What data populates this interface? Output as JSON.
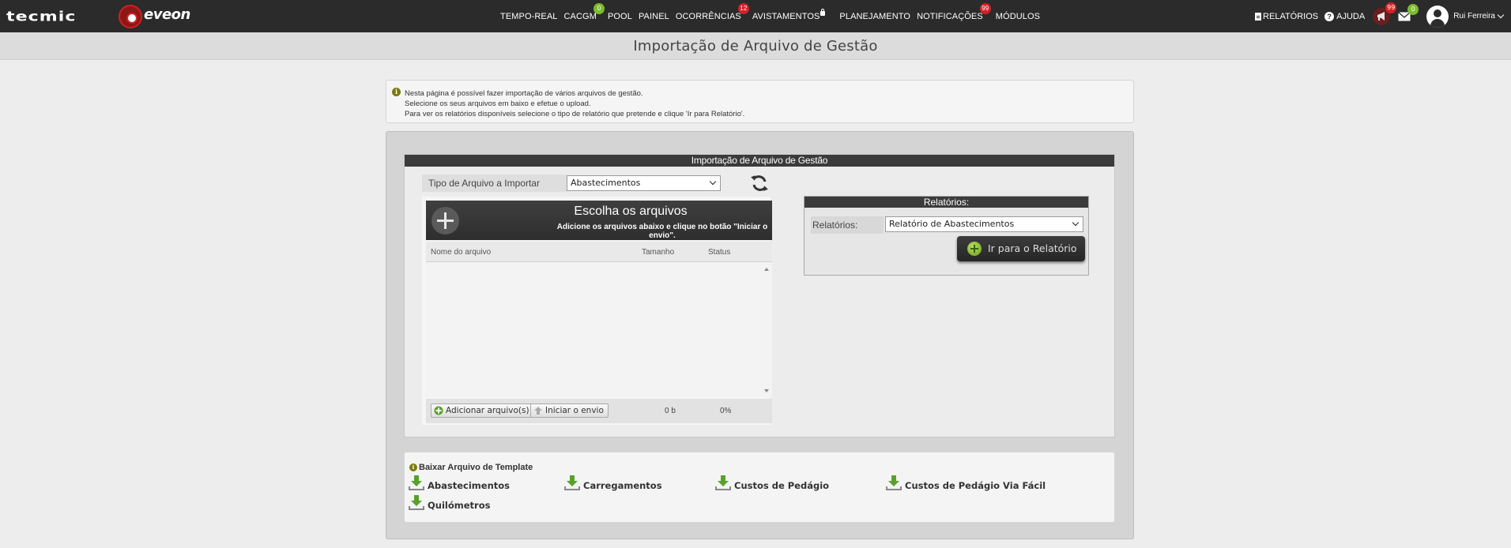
{
  "brand": {
    "logo1": "tecmic",
    "logo2": "eveon"
  },
  "nav": {
    "items": [
      {
        "label": "TEMPO-REAL"
      },
      {
        "label": "CACGM",
        "badge": "0",
        "badge_color": "#7cbd2c"
      },
      {
        "label": "POOL"
      },
      {
        "label": "PAINEL"
      },
      {
        "label": "OCORRÊNCIAS",
        "badge": "12",
        "badge_color": "#d42027"
      },
      {
        "label": "AVISTAMENTOS",
        "icon": "lock-icon"
      },
      {
        "label": "PLANEJAMENTO"
      },
      {
        "label": "NOTIFICAÇÕES",
        "badge": "99",
        "badge_color": "#d42027"
      },
      {
        "label": "MÓDULOS"
      }
    ],
    "right": {
      "reports": "RELATÓRIOS",
      "help": "AJUDA",
      "alerts_badge": "99",
      "mail_badge": "0",
      "user": "Rui Ferreira"
    }
  },
  "page": {
    "title": "Importação de Arquivo de Gestão"
  },
  "info": {
    "lines": [
      "Nesta página é possível fazer importação de vários arquivos de gestão.",
      "Selecione os seus arquivos em baixo e efetue o upload.",
      "Para ver os relatórios disponíveis selecione o tipo de relatório que pretende e clique 'Ir para Relatório'."
    ]
  },
  "import": {
    "header": "Importação de Arquivo de Gestão",
    "type_label": "Tipo de Arquivo a Importar",
    "type_value": "Abastecimentos",
    "uploader": {
      "title": "Escolha os arquivos",
      "subtitle": "Adicione os arquivos abaixo e clique no botão \"Iniciar o envio\".",
      "col_name": "Nome do arquivo",
      "col_size": "Tamanho",
      "col_status": "Status",
      "add_button": "Adicionar arquivo(s)",
      "start_button": "Iniciar o envio",
      "total_size": "0 b",
      "progress": "0%"
    }
  },
  "reports": {
    "header": "Relatórios:",
    "label": "Relatórios:",
    "value": "Relatório de Abastecimentos",
    "go_button": "Ir para o Relatório"
  },
  "templates": {
    "title": "Baixar Arquivo de Template",
    "items": [
      "Abastecimentos",
      "Carregamentos",
      "Custos de Pedágio",
      "Custos de Pedágio Via Fácil",
      "Quilómetros"
    ]
  },
  "colors": {
    "topbar": "#2b2b2b",
    "accent_green": "#7cbd2c",
    "badge_red": "#d42027"
  }
}
